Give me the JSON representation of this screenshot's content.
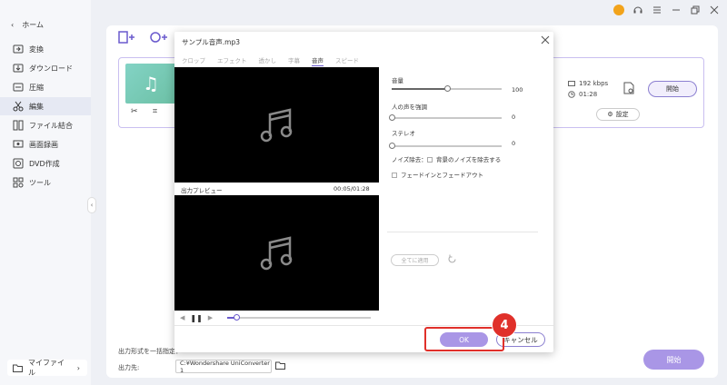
{
  "sidebar": {
    "home_label": "ホーム",
    "items": [
      {
        "label": "変換",
        "icon": "convert-icon"
      },
      {
        "label": "ダウンロード",
        "icon": "download-icon"
      },
      {
        "label": "圧縮",
        "icon": "compress-icon"
      },
      {
        "label": "編集",
        "icon": "edit-scissors-icon",
        "active": true
      },
      {
        "label": "ファイル結合",
        "icon": "merge-icon"
      },
      {
        "label": "画面録画",
        "icon": "screen-record-icon"
      },
      {
        "label": "DVD作成",
        "icon": "dvd-icon"
      },
      {
        "label": "ツール",
        "icon": "tools-icon"
      }
    ],
    "myfile_label": "マイファイル"
  },
  "file_card": {
    "bitrate": "192 kbps",
    "duration": "01:28",
    "start_label": "開始",
    "settings_label": "設定"
  },
  "bottom": {
    "output_format_label": "出力形式を一括指定：",
    "output_dest_label": "出力先:",
    "output_path": "C:¥Wondershare UniConverter 1",
    "start_label": "開始"
  },
  "dialog": {
    "title": "サンプル音声.mp3",
    "tabs": [
      {
        "label": "クロップ"
      },
      {
        "label": "エフェクト"
      },
      {
        "label": "透かし"
      },
      {
        "label": "字幕"
      },
      {
        "label": "音声",
        "active": true
      },
      {
        "label": "スピード"
      }
    ],
    "preview_label": "出力プレビュー",
    "preview_time": "00:05/01:28",
    "volume": {
      "label": "音量",
      "value": "100",
      "level": 0.5
    },
    "vocal": {
      "label": "人の声を強調",
      "value": "0",
      "level": 0.0
    },
    "stereo": {
      "label": "ステレオ",
      "value": "0",
      "level": 0.0
    },
    "noise_label": "ノイズ除去：",
    "noise_option": "背景のノイズを除去する",
    "fade_option": "フェードインとフェードアウト",
    "apply_all_label": "全てに適用",
    "ok_label": "OK",
    "cancel_label": "キャンセル",
    "playback_progress": 0.06
  },
  "annotation": {
    "step_number": "4"
  },
  "colors": {
    "accent": "#a996e6",
    "highlight": "#e0302a",
    "preview_bg": "#000000"
  }
}
